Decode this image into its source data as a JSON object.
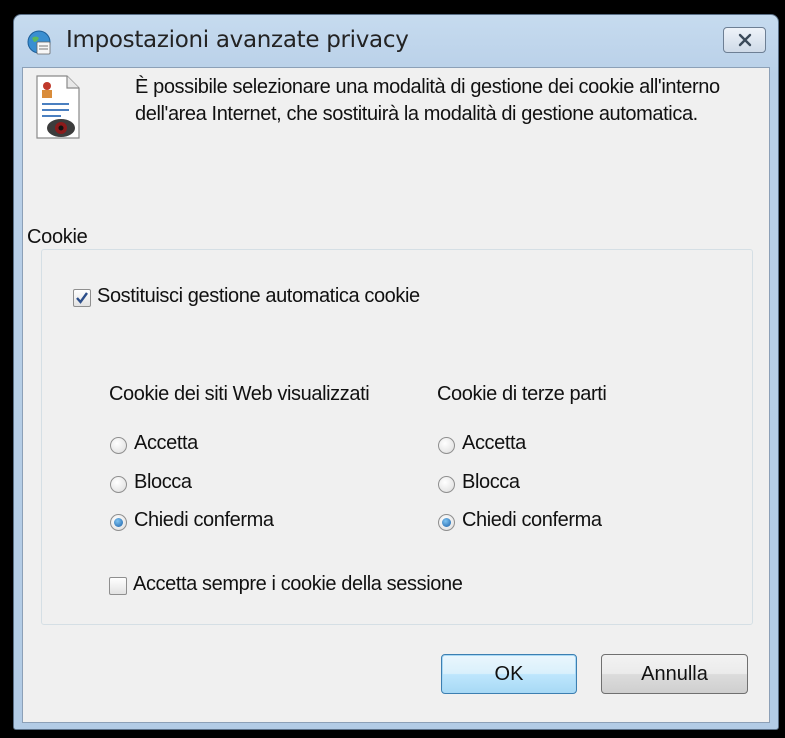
{
  "window": {
    "title": "Impostazioni avanzate privacy"
  },
  "description": "È possibile selezionare una modalità di gestione dei cookie all'interno dell'area Internet, che sostituirà la modalità di gestione automatica.",
  "cookie_group": {
    "label": "Cookie",
    "override_checkbox": {
      "label": "Sostituisci gestione automatica cookie",
      "checked": true
    },
    "first_party": {
      "heading": "Cookie dei siti Web visualizzati",
      "options": [
        "Accetta",
        "Blocca",
        "Chiedi conferma"
      ],
      "selected": "Chiedi conferma"
    },
    "third_party": {
      "heading": "Cookie di terze parti",
      "options": [
        "Accetta",
        "Blocca",
        "Chiedi conferma"
      ],
      "selected": "Chiedi conferma"
    },
    "session_checkbox": {
      "label": "Accetta sempre i cookie della sessione",
      "checked": false
    }
  },
  "buttons": {
    "ok": "OK",
    "cancel": "Annulla"
  },
  "icons": {
    "title_icon": "globe-privacy-icon",
    "doc_icon": "privacy-document-icon",
    "close": "close-icon"
  }
}
